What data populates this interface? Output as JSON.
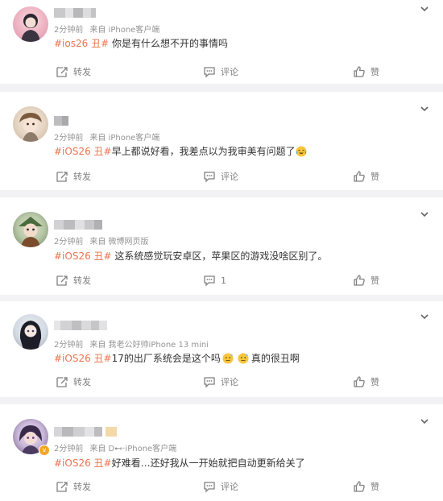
{
  "comments": [
    {
      "time": "2分钟前",
      "source": "来自 iPhone客户端",
      "tag": "#ios26 丑#",
      "text": " 你是有什么想不开的事情吗",
      "actions": {
        "forward": "转发",
        "comment": "评论",
        "like": "赞"
      }
    },
    {
      "time": "2分钟前",
      "source": "来自 iPhone客户端",
      "tag": "#iOS26 丑#",
      "text": "早上都说好看，我差点以为我审美有问题了",
      "actions": {
        "forward": "转发",
        "comment": "评论",
        "like": "赞"
      }
    },
    {
      "time": "2分钟前",
      "source": "来自 微博网页版",
      "tag": "#iOS26 丑#",
      "text": " 这系统感觉玩安卓区，苹果区的游戏没啥区别了。",
      "actions": {
        "forward": "转发",
        "comment": "1",
        "like": "赞"
      }
    },
    {
      "time": "2分钟前",
      "source": "来自 我老公好帅iPhone 13 mini",
      "tag": "#iOS26 丑#",
      "text_a": "17的出厂系统会是这个吗",
      "text_b": "真的很丑啊",
      "actions": {
        "forward": "转发",
        "comment": "评论",
        "like": "赞"
      }
    },
    {
      "time": "2分钟前",
      "source": "来自 D⊷·iPhone客户端",
      "tag": "#iOS26 丑#",
      "text": "好难看…还好我从一开始就把自动更新给关了",
      "actions": {
        "forward": "转发",
        "comment": "评论",
        "like": "赞"
      }
    }
  ],
  "colors": {
    "tag": "#eb7350",
    "meta": "#939393",
    "background": "#f2f2f5"
  },
  "icons": [
    "chevron-down-icon",
    "forward-icon",
    "comment-icon",
    "like-icon"
  ]
}
